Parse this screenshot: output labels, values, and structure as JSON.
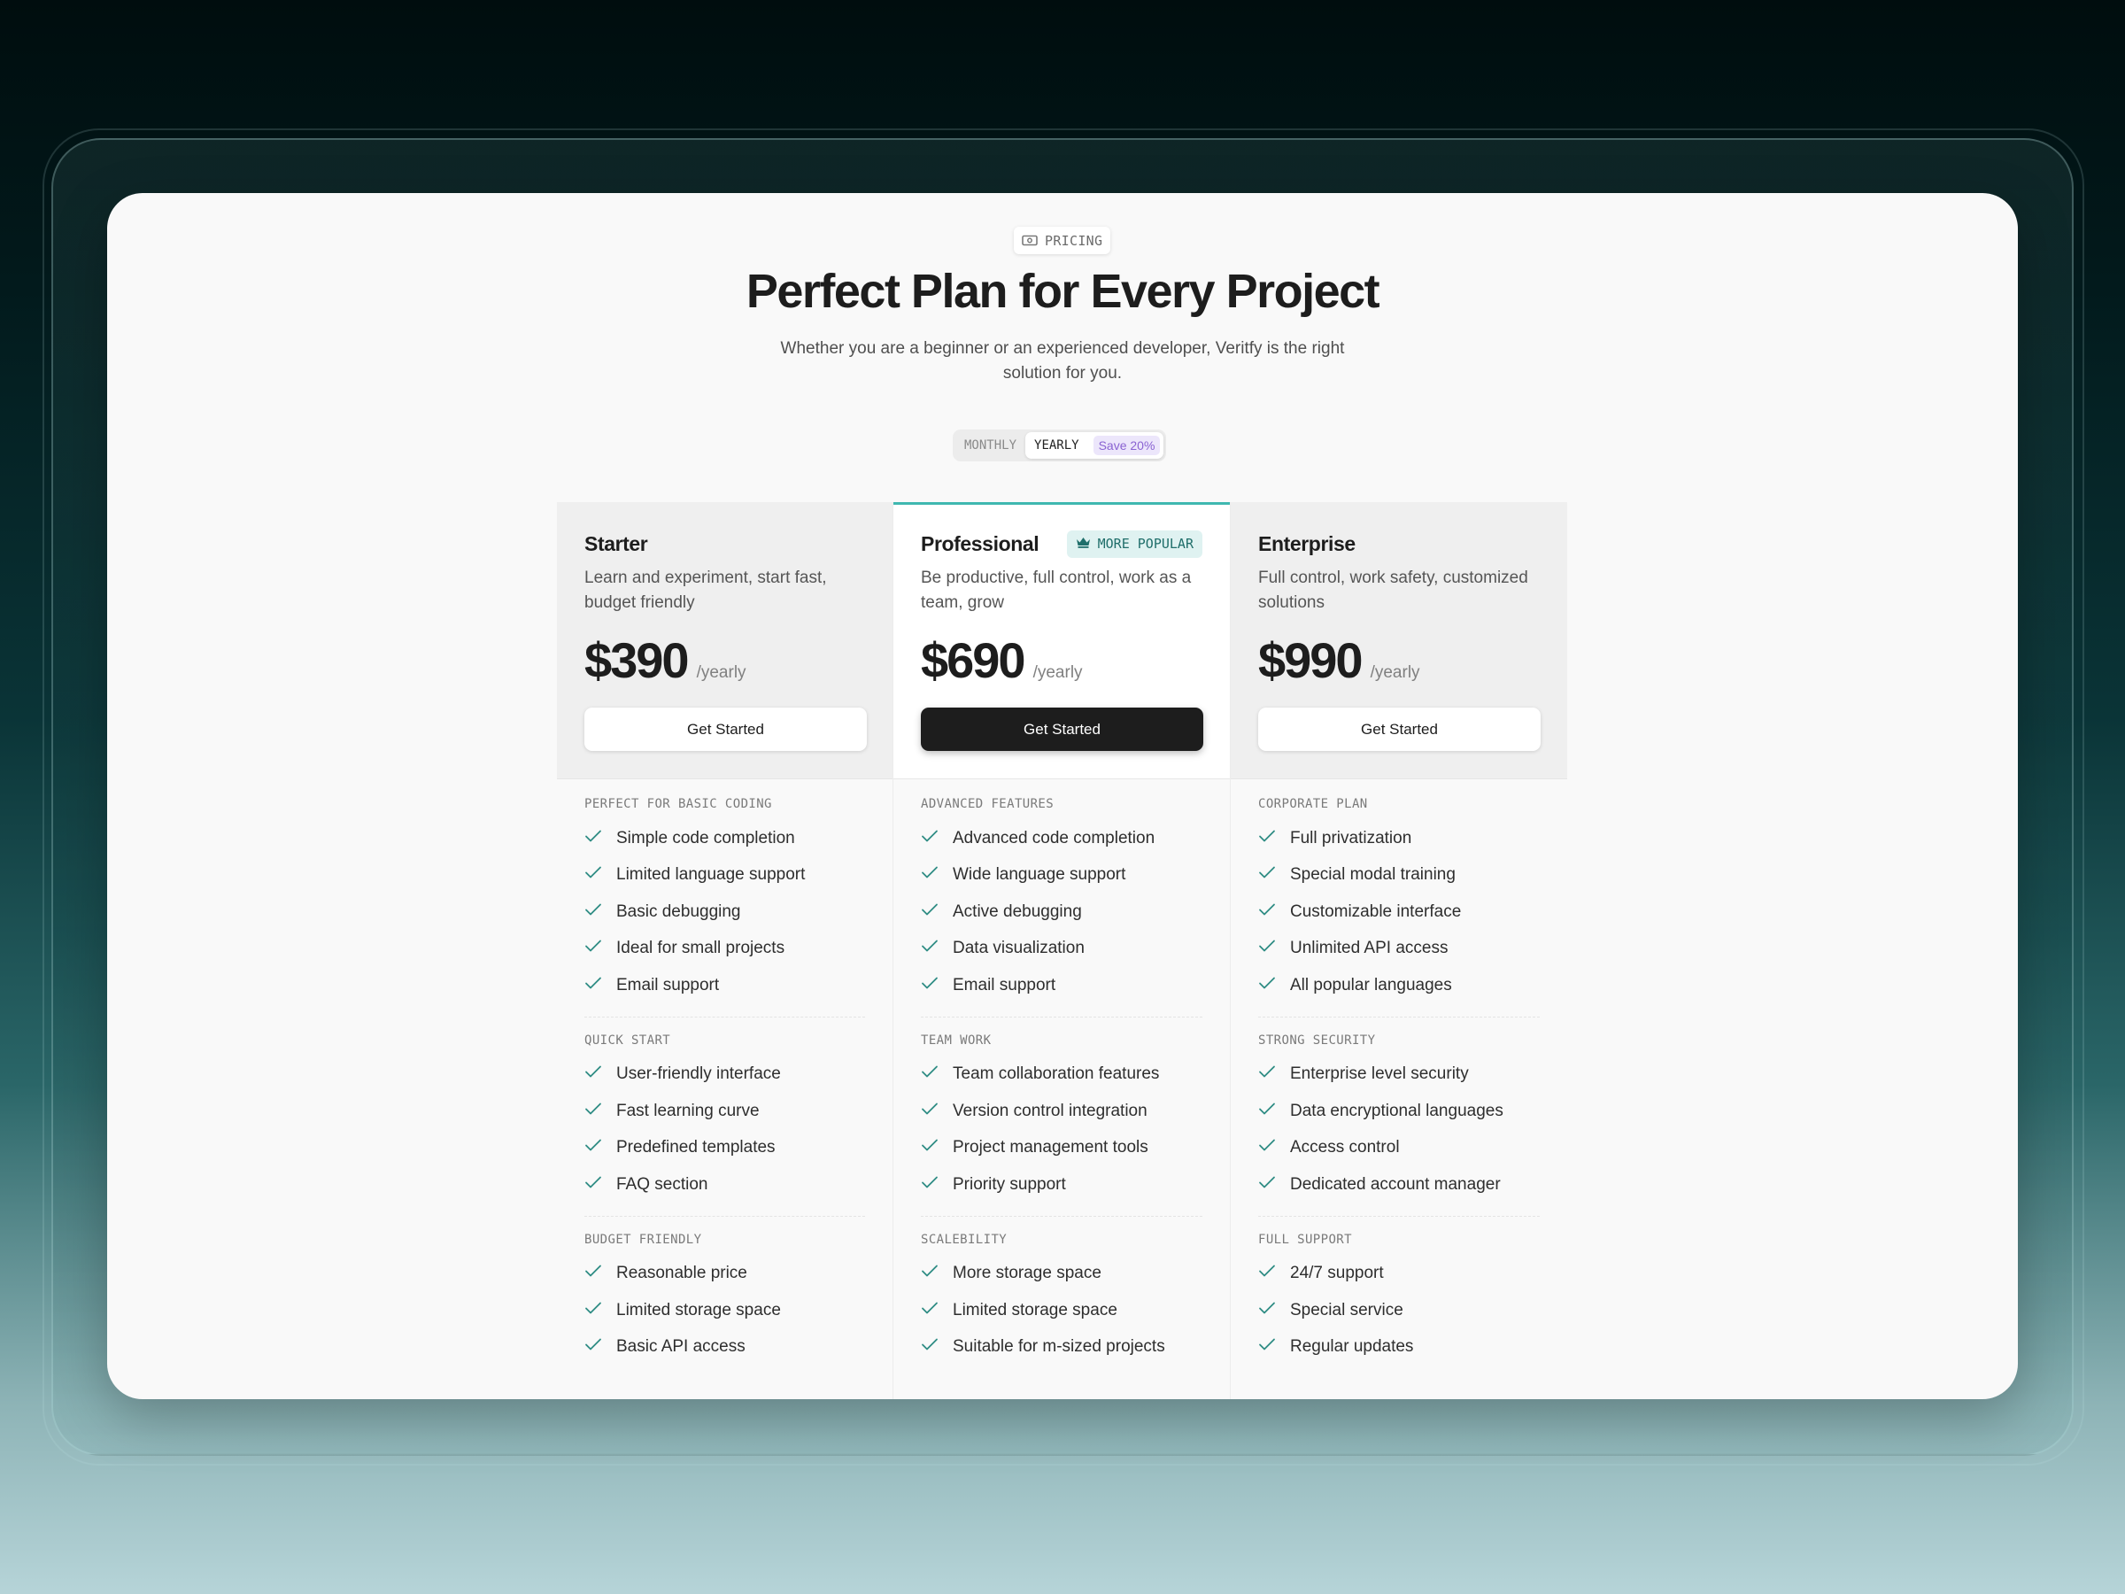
{
  "header": {
    "tag_label": "PRICING",
    "tag_icon": "banknote-icon",
    "title": "Perfect Plan for Every Project",
    "subtitle": "Whether you are a beginner or an experienced developer, Veritfy is the right solution for you."
  },
  "billing_toggle": {
    "options": [
      "MONTHLY",
      "YEARLY"
    ],
    "selected": "YEARLY",
    "save_badge": "Save 20%"
  },
  "colors": {
    "accent": "#3fb8b0",
    "check": "#2f8c84",
    "badge_bg": "#dff2f1",
    "save_badge": "#8a63d2",
    "primary_button": "#1d1d1d"
  },
  "plans": [
    {
      "name": "Starter",
      "description": "Learn and experiment, start fast, budget friendly",
      "price": "$390",
      "period": "/yearly",
      "cta": "Get Started",
      "groups": [
        {
          "title": "PERFECT FOR BASIC CODING",
          "features": [
            "Simple code completion",
            "Limited language support",
            "Basic debugging",
            "Ideal for small projects",
            "Email support"
          ]
        },
        {
          "title": "QUICK START",
          "features": [
            "User-friendly interface",
            "Fast learning curve",
            "Predefined templates",
            "FAQ section"
          ]
        },
        {
          "title": "BUDGET FRIENDLY",
          "features": [
            "Reasonable price",
            "Limited storage space",
            "Basic API access"
          ]
        }
      ]
    },
    {
      "name": "Professional",
      "badge": "MORE POPULAR",
      "badge_icon": "crown-icon",
      "description": "Be productive, full control, work as a team, grow",
      "price": "$690",
      "period": "/yearly",
      "cta": "Get Started",
      "groups": [
        {
          "title": "ADVANCED FEATURES",
          "features": [
            "Advanced code completion",
            "Wide language support",
            "Active debugging",
            "Data visualization",
            "Email support"
          ]
        },
        {
          "title": "TEAM WORK",
          "features": [
            "Team collaboration features",
            "Version control integration",
            "Project management tools",
            "Priority support"
          ]
        },
        {
          "title": "SCALEBILITY",
          "features": [
            "More storage space",
            "Limited storage space",
            "Suitable for m-sized projects"
          ]
        }
      ]
    },
    {
      "name": "Enterprise",
      "description": "Full control, work safety, customized solutions",
      "price": "$990",
      "period": "/yearly",
      "cta": "Get Started",
      "groups": [
        {
          "title": "CORPORATE PLAN",
          "features": [
            "Full privatization",
            "Special modal training",
            "Customizable interface",
            "Unlimited API access",
            "All popular languages"
          ]
        },
        {
          "title": "STRONG SECURITY",
          "features": [
            "Enterprise level security",
            "Data encryptional languages",
            "Access control",
            "Dedicated account manager"
          ]
        },
        {
          "title": "FULL SUPPORT",
          "features": [
            "24/7 support",
            "Special service",
            "Regular updates"
          ]
        }
      ]
    }
  ]
}
